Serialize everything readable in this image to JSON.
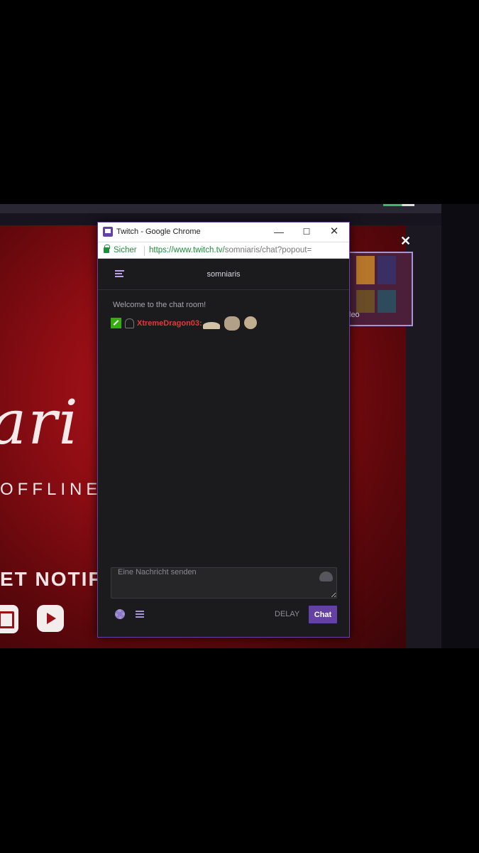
{
  "background_page": {
    "banner_logo_text": "ari",
    "banner_status": "OFFLINE",
    "banner_notify": "ET NOTIFIE",
    "video_label": "leo",
    "close_glyph": "✕",
    "icons": [
      "twitch-icon",
      "youtube-icon",
      "close-icon"
    ]
  },
  "window": {
    "title": "Twitch - Google Chrome",
    "minimize_glyph": "—",
    "maximize_glyph": "☐",
    "close_glyph": "✕"
  },
  "address_bar": {
    "secure_label": "Sicher",
    "url_host": "https://www.twitch.tv/",
    "url_path": "somniaris/chat?popout="
  },
  "chat": {
    "channel_name": "somniaris",
    "welcome_message": "Welcome to the chat room!",
    "messages": [
      {
        "username": "XtremeDragon03:",
        "badges": [
          "moderator-badge",
          "subscriber-badge"
        ],
        "emotes": [
          "emote-1",
          "emote-2",
          "emote-3"
        ]
      }
    ],
    "input_placeholder": "Eine Nachricht senden",
    "delay_label": "DELAY",
    "send_label": "Chat"
  },
  "colors": {
    "twitch_purple": "#6441a4",
    "username_red": "#e4393c",
    "secure_green": "#1e8e3e",
    "mod_green": "#34ae0a"
  }
}
